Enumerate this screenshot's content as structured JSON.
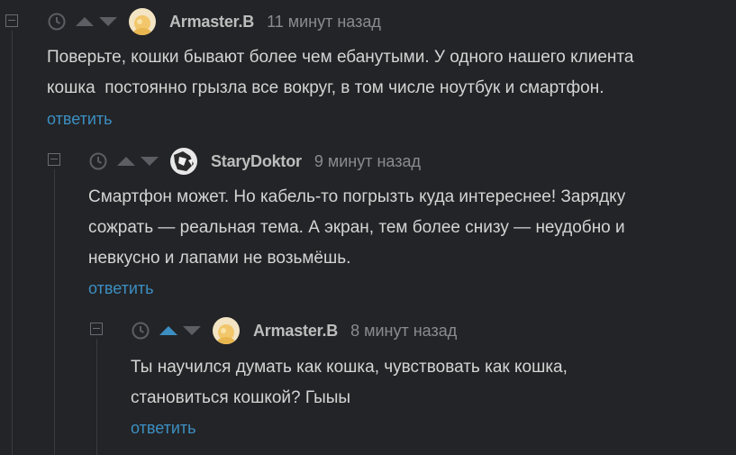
{
  "comments": [
    {
      "username": "Armaster.B",
      "time": "11 минут назад",
      "text": "Поверьте, кошки бывают более чем ебанутыми. У одного нашего клиента\nкошка  постоянно грызла все вокруг, в том числе ноутбук и смартфон.",
      "reply_label": "ответить",
      "avatar": "sun-avatar-icon",
      "upvote_active": false
    },
    {
      "username": "StaryDoktor",
      "time": "9 минут назад",
      "text": "Смартфон может. Но кабель-то погрызть куда интереснее! Зарядку\nсожрать — реальная тема. А экран, тем более снизу — неудобно и\nневкусно и лапами не возьмёшь.",
      "reply_label": "ответить",
      "avatar": "bw-avatar-icon",
      "upvote_active": false
    },
    {
      "username": "Armaster.B",
      "time": "8 минут назад",
      "text": "Ты научился думать как кошка, чувствовать как кошка,\nстановиться кошкой? Гыыы",
      "reply_label": "ответить",
      "avatar": "sun-avatar-icon",
      "upvote_active": true
    }
  ],
  "colors": {
    "background": "#232427",
    "link": "#3c8fc2",
    "vote_active": "#3c8fc2",
    "vote_inactive": "#5d5e63"
  }
}
